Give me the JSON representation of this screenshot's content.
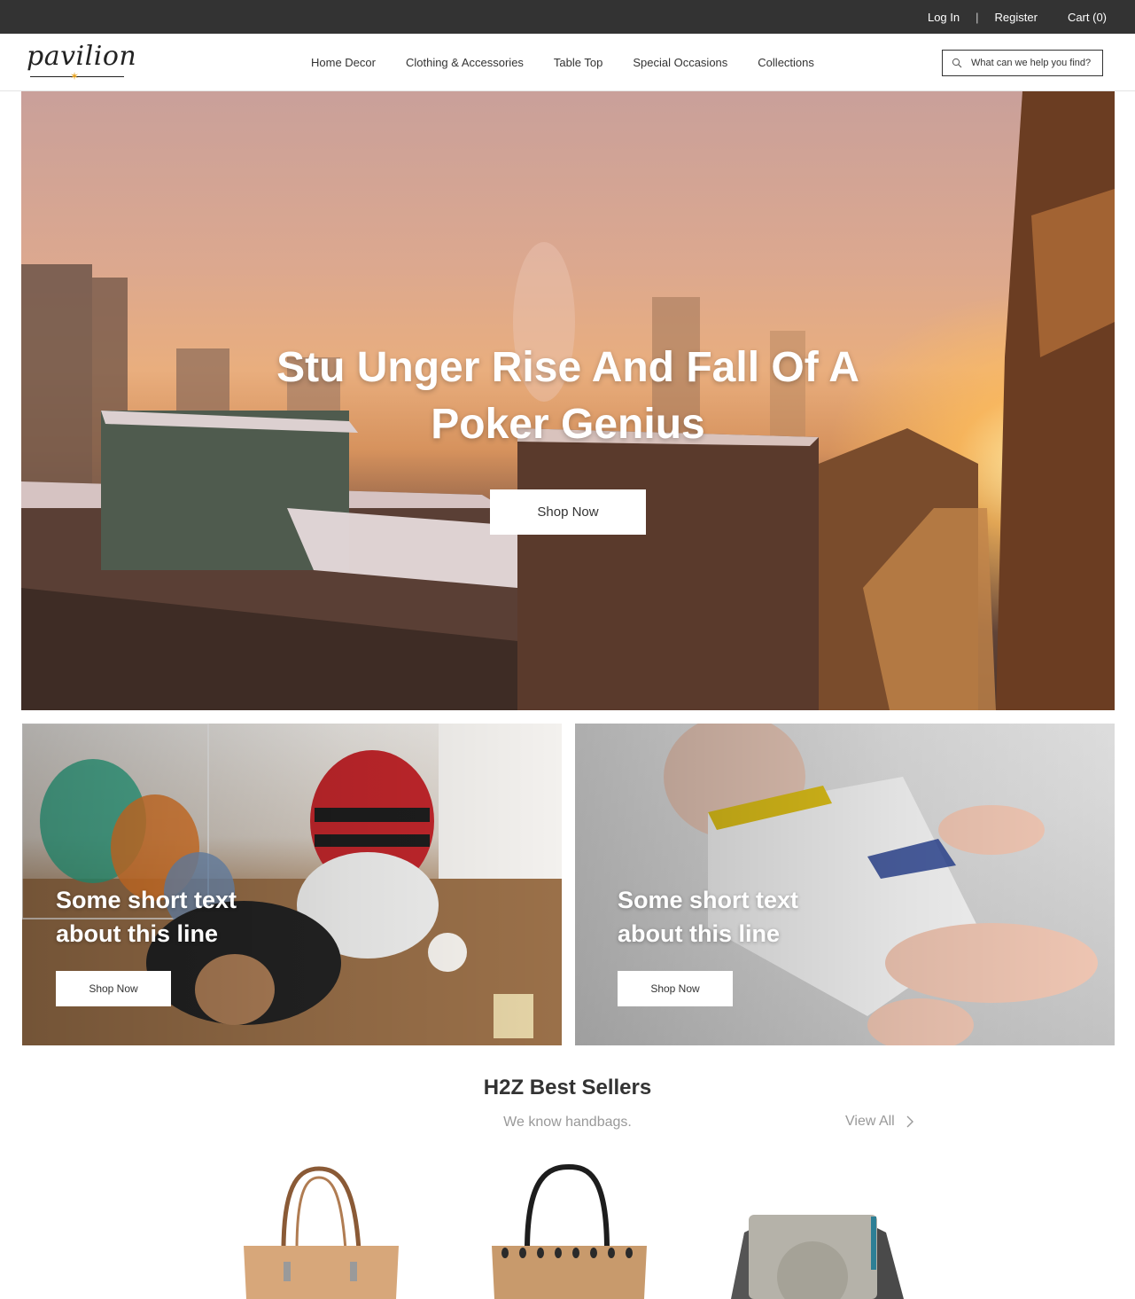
{
  "topbar": {
    "login": "Log In",
    "separator": "|",
    "register": "Register",
    "cart": "Cart (0)"
  },
  "header": {
    "logo_text": "pavilion",
    "nav": [
      {
        "label": "Home Decor"
      },
      {
        "label": "Clothing & Accessories"
      },
      {
        "label": "Table Top"
      },
      {
        "label": "Special Occasions"
      },
      {
        "label": "Collections"
      }
    ],
    "search": {
      "placeholder": "What can we help you find?",
      "icon": "search-icon"
    }
  },
  "hero": {
    "title_line1": "Stu Unger Rise And Fall Of A",
    "title_line2": "Poker Genius",
    "button_label": "Shop Now"
  },
  "tiles": [
    {
      "line1": "Some short text",
      "line2": "about this line",
      "button_label": "Shop Now"
    },
    {
      "line1": "Some short text",
      "line2": "about this line",
      "button_label": "Shop Now"
    }
  ],
  "best_sellers": {
    "title": "H2Z Best Sellers",
    "subtitle": "We know handbags.",
    "view_all": "View All"
  },
  "colors": {
    "topbar_bg": "#333333",
    "accent_star": "#e8a21c",
    "muted_text": "#999999"
  }
}
